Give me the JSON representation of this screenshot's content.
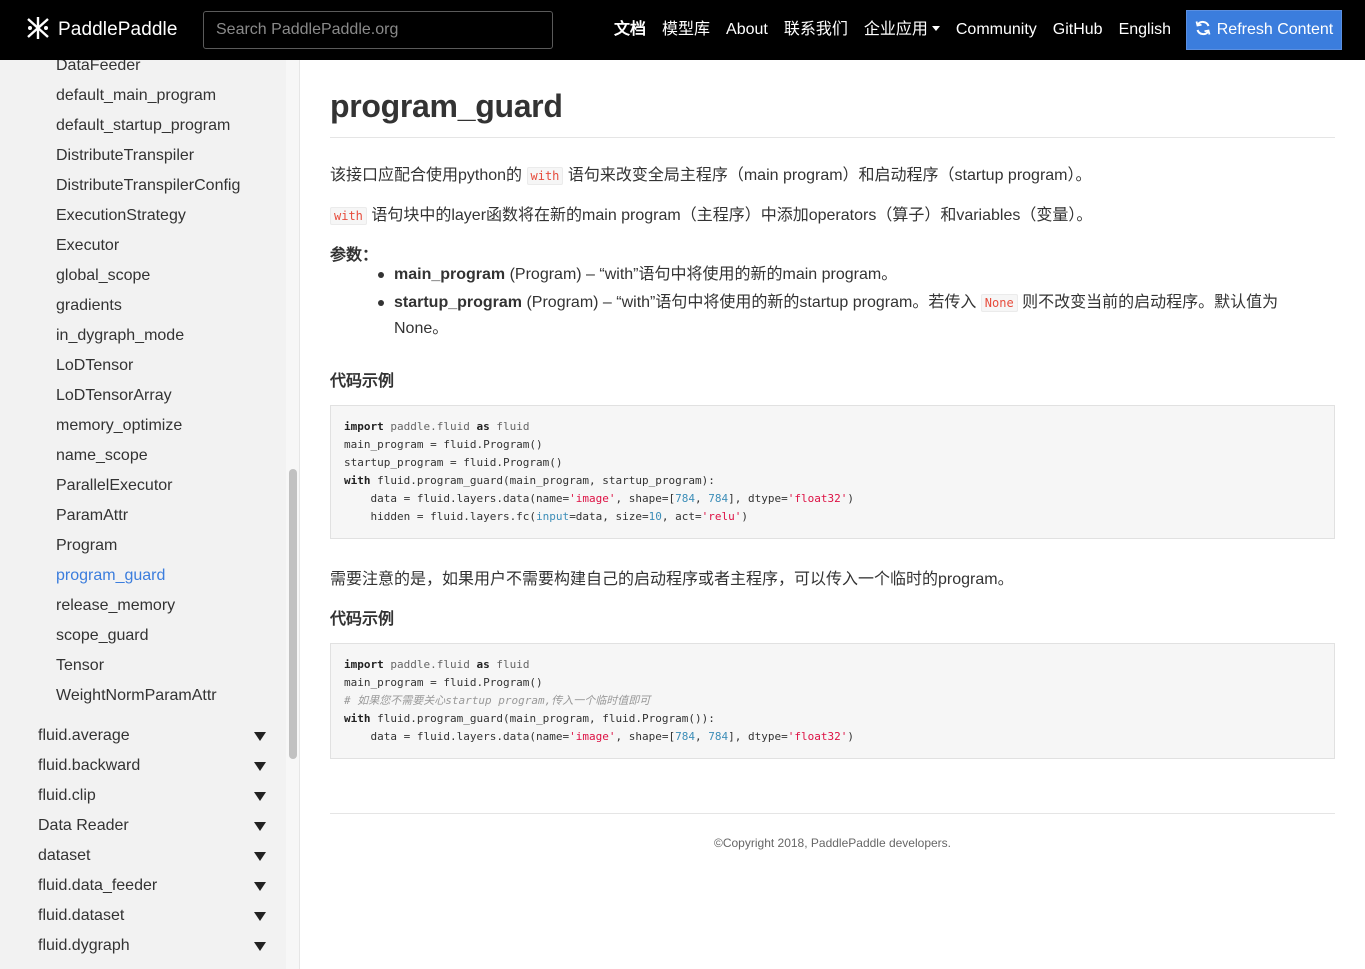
{
  "header": {
    "brand": "PaddlePaddle",
    "search_placeholder": "Search PaddlePaddle.org",
    "nav": [
      {
        "label": "文档"
      },
      {
        "label": "模型库"
      },
      {
        "label": "About"
      },
      {
        "label": "联系我们"
      },
      {
        "label": "企业应用"
      },
      {
        "label": "Community"
      },
      {
        "label": "GitHub"
      },
      {
        "label": "English"
      }
    ],
    "refresh_label": "Refresh Content"
  },
  "sidebar": {
    "sub_items": [
      "DataFeeder",
      "default_main_program",
      "default_startup_program",
      "DistributeTranspiler",
      "DistributeTranspilerConfig",
      "ExecutionStrategy",
      "Executor",
      "global_scope",
      "gradients",
      "in_dygraph_mode",
      "LoDTensor",
      "LoDTensorArray",
      "memory_optimize",
      "name_scope",
      "ParallelExecutor",
      "ParamAttr",
      "Program",
      "program_guard",
      "release_memory",
      "scope_guard",
      "Tensor",
      "WeightNormParamAttr"
    ],
    "current_item": "program_guard",
    "sections": [
      "fluid.average",
      "fluid.backward",
      "fluid.clip",
      "Data Reader",
      "dataset",
      "fluid.data_feeder",
      "fluid.dataset",
      "fluid.dygraph"
    ]
  },
  "main": {
    "title": "program_guard",
    "p1_before": "该接口应配合使用python的 ",
    "p1_code": "with",
    "p1_after": " 语句来改变全局主程序（main program）和启动程序（startup program）。",
    "p2_code": "with",
    "p2_after": " 语句块中的layer函数将在新的main program（主程序）中添加operators（算子）和variables（变量）。",
    "params_label": "参数：",
    "param1_name": "main_program",
    "param1_desc": " (Program) – “with”语句中将使用的新的main program。",
    "param2_name": "startup_program",
    "param2_desc_before": " (Program) – “with”语句中将使用的新的startup program。若传入 ",
    "param2_code": "None",
    "param2_desc_after": " 则不改变当前的启动程序。默认值为None。",
    "example_heading_1": "代码示例",
    "note": "需要注意的是，如果用户不需要构建自己的启动程序或者主程序，可以传入一个临时的program。",
    "example_heading_2": "代码示例",
    "copyright": "©Copyright 2018, PaddlePaddle developers."
  },
  "code1": {
    "l1_kw": "import",
    "l1_mod": " paddle.fluid ",
    "l1_as": "as",
    "l1_alias": " fluid",
    "l2": "main_program = fluid.Program()",
    "l3": "startup_program = fluid.Program()",
    "l4_kw": "with",
    "l4_rest": " fluid.program_guard(main_program, startup_program):",
    "l5_a": "    data = fluid.layers.data(name=",
    "l5_str1": "'image'",
    "l5_b": ", shape=[",
    "l5_n1": "784",
    "l5_c": ", ",
    "l5_n2": "784",
    "l5_d": "], dtype=",
    "l5_str2": "'float32'",
    "l5_e": ")",
    "l6_a": "    hidden = fluid.layers.fc(",
    "l6_bi": "input",
    "l6_b": "=data, size=",
    "l6_n": "10",
    "l6_c": ", act=",
    "l6_str": "'relu'",
    "l6_d": ")"
  },
  "code2": {
    "l1_kw": "import",
    "l1_mod": " paddle.fluid ",
    "l1_as": "as",
    "l1_alias": " fluid",
    "l2": "main_program = fluid.Program()",
    "l3_comment": "# 如果您不需要关心startup program,传入一个临时值即可",
    "l4_kw": "with",
    "l4_rest": " fluid.program_guard(main_program, fluid.Program()):",
    "l5_a": "    data = fluid.layers.data(name=",
    "l5_str1": "'image'",
    "l5_b": ", shape=[",
    "l5_n1": "784",
    "l5_c": ", ",
    "l5_n2": "784",
    "l5_d": "], dtype=",
    "l5_str2": "'float32'",
    "l5_e": ")"
  }
}
